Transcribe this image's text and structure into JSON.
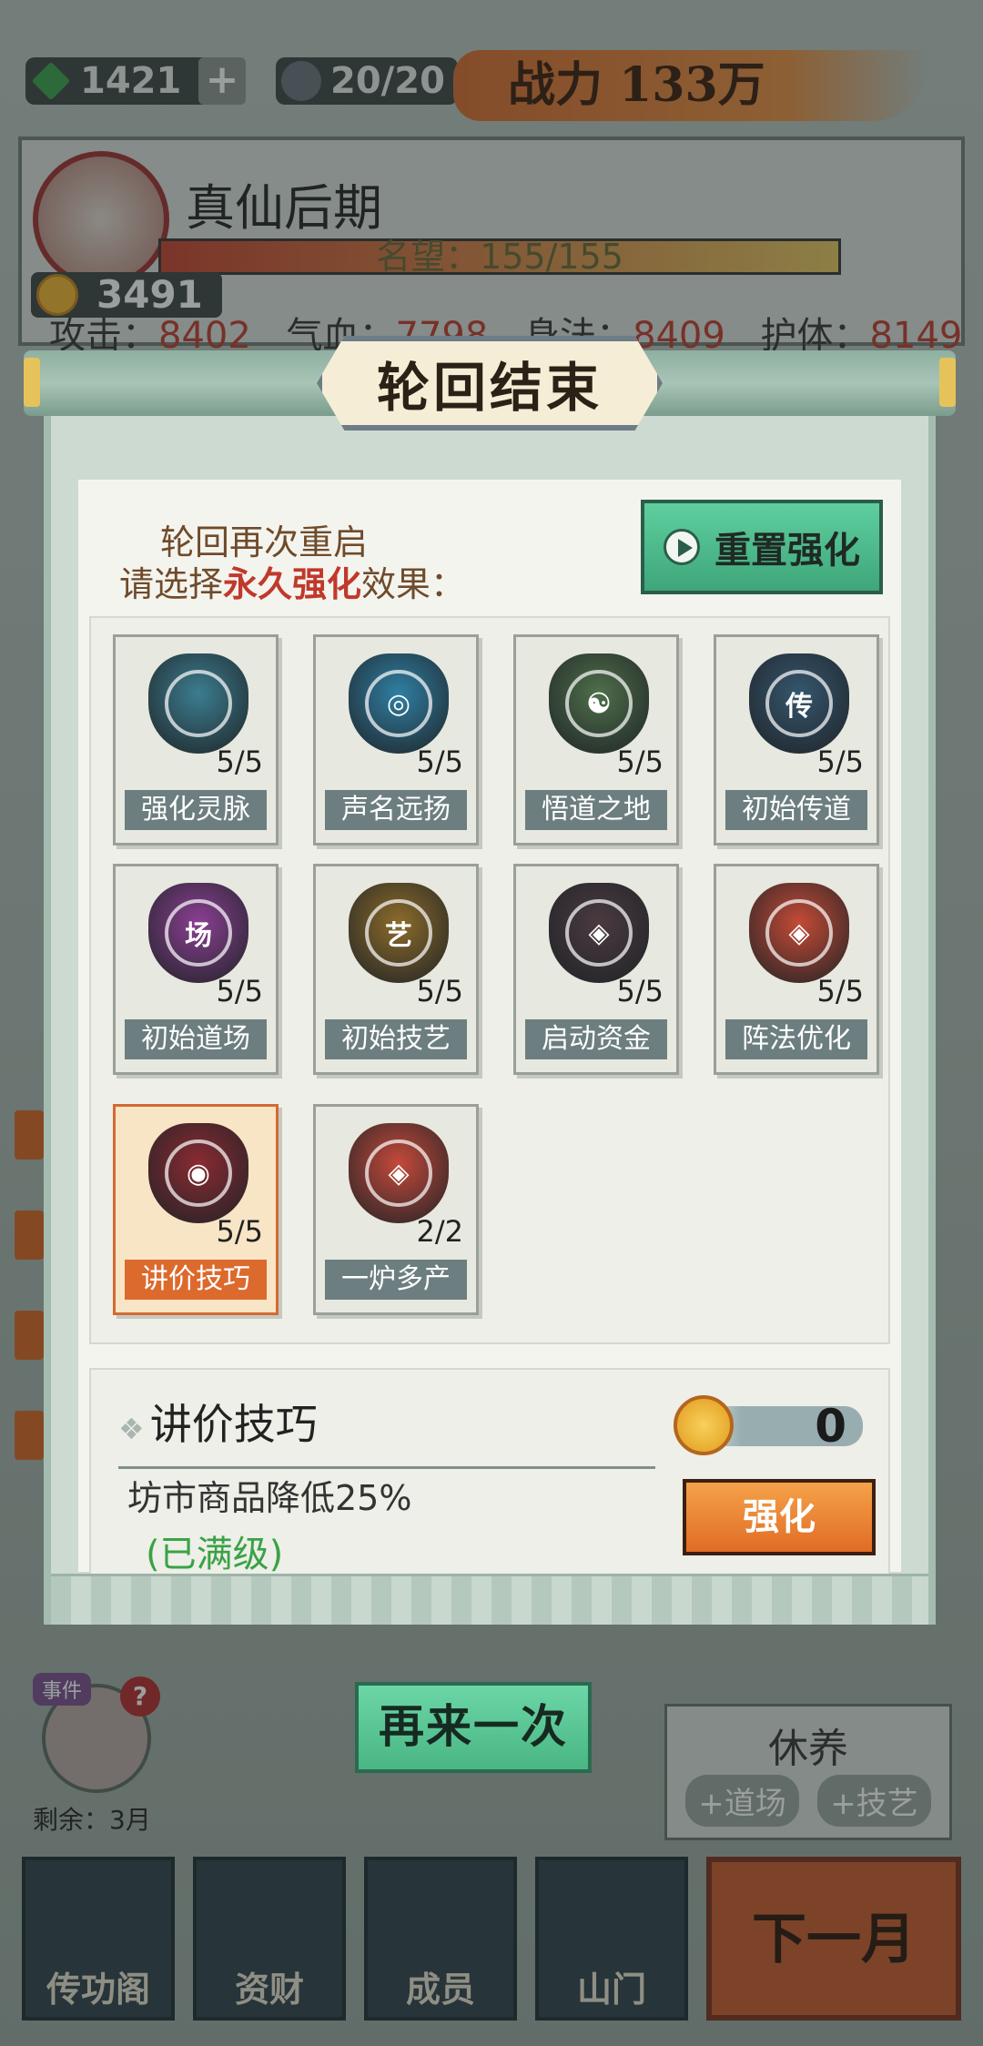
{
  "topbar": {
    "jade": "1421",
    "plus": "+",
    "people": "20/20",
    "power": "战力 133万"
  },
  "profile": {
    "rank": "真仙后期",
    "fame": "名望：155/155",
    "coins": "3491",
    "stats": [
      {
        "label": "攻击：",
        "value": "8402"
      },
      {
        "label": "气血：",
        "value": "7798"
      },
      {
        "label": "身法：",
        "value": "8409"
      },
      {
        "label": "护体：",
        "value": "8149"
      }
    ]
  },
  "dialog": {
    "title": "轮回结束",
    "intro_line1": "轮回再次重启",
    "intro_line2_a": "请选择",
    "intro_line2_hl": "永久强化",
    "intro_line2_b": "效果：",
    "reset_label": "重置强化",
    "cards": [
      {
        "name": "强化灵脉",
        "level": "5/5",
        "glyph": "",
        "color": "#3b7d8f"
      },
      {
        "name": "声名远扬",
        "level": "5/5",
        "glyph": "◎",
        "color": "#2f7fa3"
      },
      {
        "name": "悟道之地",
        "level": "5/5",
        "glyph": "☯",
        "color": "#4e6f4a"
      },
      {
        "name": "初始传道",
        "level": "5/5",
        "glyph": "传",
        "color": "#35566e"
      },
      {
        "name": "初始道场",
        "level": "5/5",
        "glyph": "场",
        "color": "#8a3f92"
      },
      {
        "name": "初始技艺",
        "level": "5/5",
        "glyph": "艺",
        "color": "#8c6b2a"
      },
      {
        "name": "启动资金",
        "level": "5/5",
        "glyph": "◈",
        "color": "#4a3a40"
      },
      {
        "name": "阵法优化",
        "level": "5/5",
        "glyph": "◈",
        "color": "#c44a36"
      },
      {
        "name": "讲价技巧",
        "level": "5/5",
        "glyph": "◉",
        "color": "#8a2a32"
      },
      {
        "name": "一炉多产",
        "level": "2/2",
        "glyph": "◈",
        "color": "#c4493a"
      }
    ],
    "detail": {
      "name": "讲价技巧",
      "desc": "坊市商品降低25%",
      "status": "(已满级)",
      "cost": "0",
      "button": "强化"
    }
  },
  "again_label": "再来一次",
  "event": {
    "tag": "事件",
    "q": "?",
    "remaining": "剩余：3月"
  },
  "rest": {
    "title": "休养",
    "tags": [
      "+道场",
      "+技艺"
    ]
  },
  "nav": [
    "传功阁",
    "资财",
    "成员",
    "山门"
  ],
  "next_label": "下一月"
}
